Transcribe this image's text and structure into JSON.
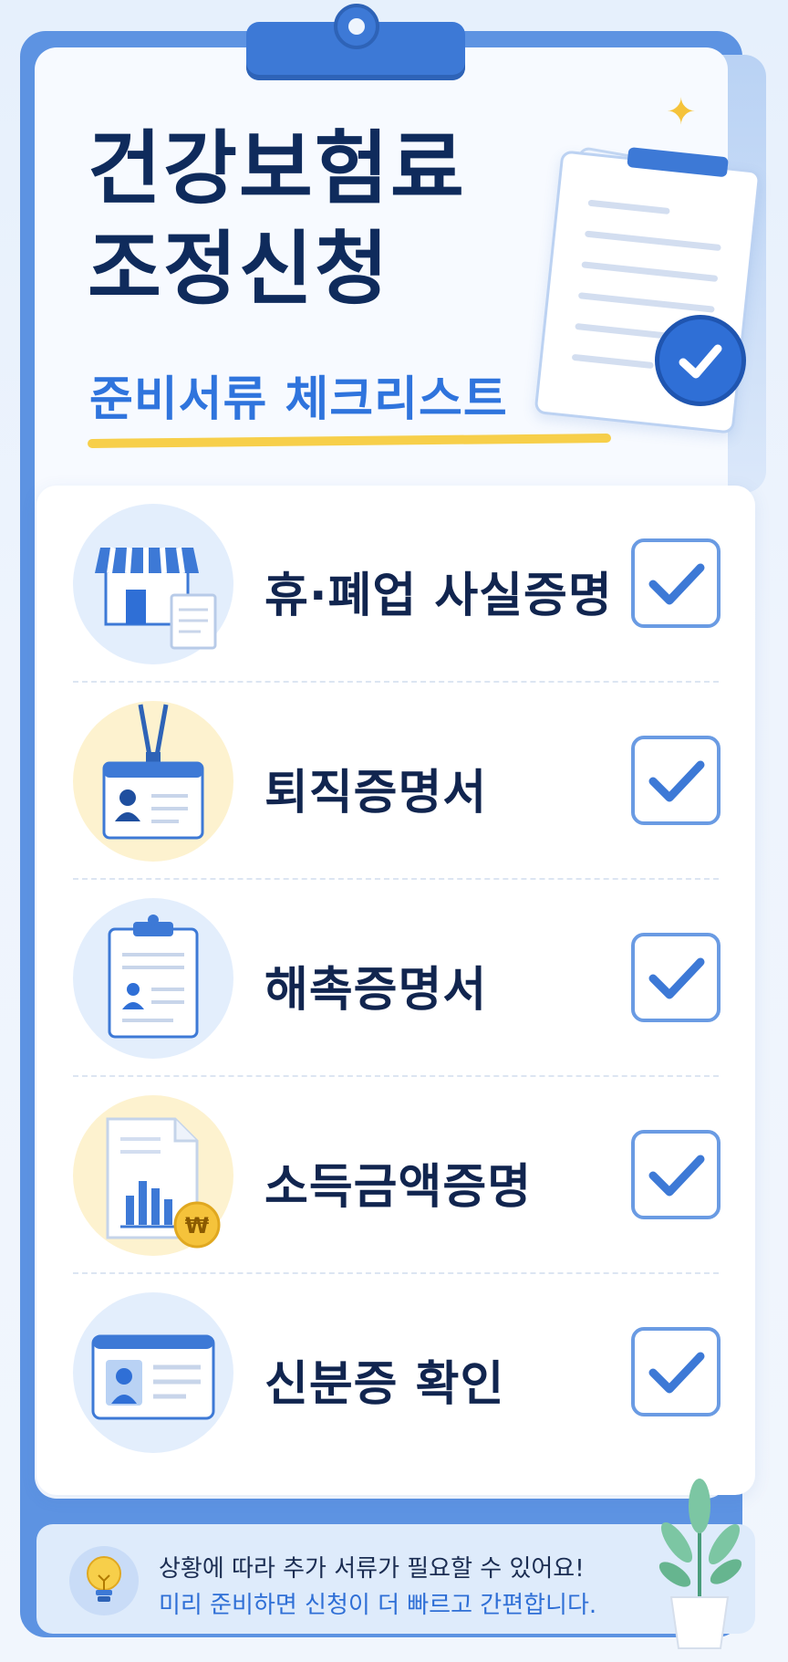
{
  "header": {
    "title_line1": "건강보험료",
    "title_line2": "조정신청",
    "subtitle": "준비서류 체크리스트"
  },
  "checklist": {
    "items": [
      {
        "label": "휴·폐업 사실증명",
        "icon": "store-icon",
        "checked": true
      },
      {
        "label": "퇴직증명서",
        "icon": "id-badge-icon",
        "checked": true
      },
      {
        "label": "해촉증명서",
        "icon": "clipboard-icon",
        "checked": true
      },
      {
        "label": "소득금액증명",
        "icon": "income-chart-icon",
        "checked": true
      },
      {
        "label": "신분증 확인",
        "icon": "id-card-icon",
        "checked": true
      }
    ]
  },
  "tip": {
    "line1": "상황에 따라 추가 서류가 필요할 수 있어요!",
    "line2": "미리 준비하면 신청이 더 빠르고 간편합니다.",
    "icon": "lightbulb-icon"
  },
  "colors": {
    "accent": "#2f74dd",
    "title": "#0f2b5c",
    "highlight": "#f7cf4a"
  }
}
